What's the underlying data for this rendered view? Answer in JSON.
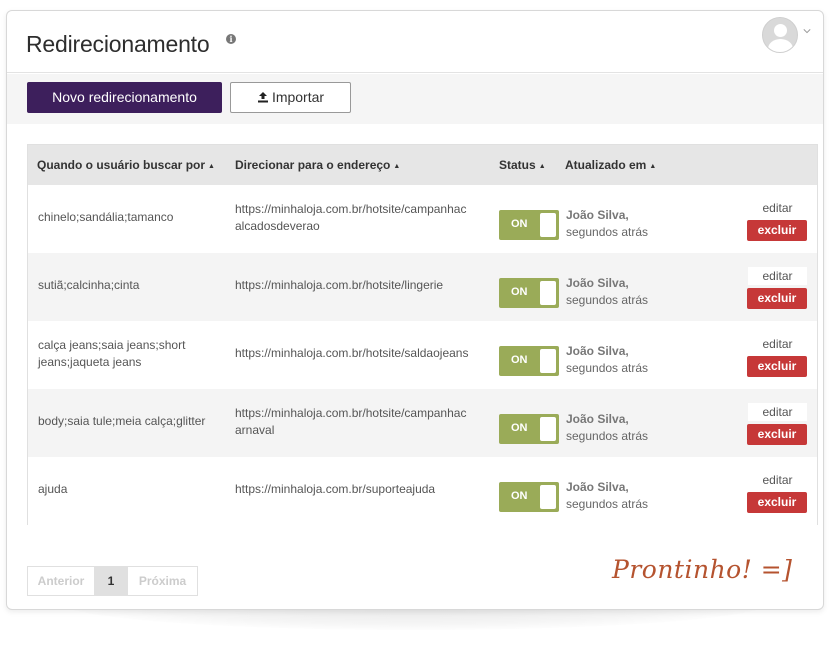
{
  "header": {
    "title": "Redirecionamento",
    "info_icon": "info-icon",
    "avatar_icon": "user-avatar-icon",
    "menu_icon": "chevron-down-icon"
  },
  "toolbar": {
    "new_label": "Novo redirecionamento",
    "import_label": "Importar",
    "import_icon": "upload-icon",
    "primary_color": "#3d1f5c"
  },
  "table": {
    "columns": [
      {
        "label": "Quando o usuário buscar por",
        "sort_icon": "sort-up-icon"
      },
      {
        "label": "Direcionar para o endereço",
        "sort_icon": "sort-up-icon"
      },
      {
        "label": "Status",
        "sort_icon": "sort-up-icon"
      },
      {
        "label": "Atualizado em",
        "sort_icon": "sort-up-icon"
      }
    ],
    "rows": [
      {
        "query_lines": [
          "chinelo;sandália;tamanco"
        ],
        "url_lines": [
          "https://minhaloja.com.br/hotsite/campanhac",
          "alcadosdeverao"
        ],
        "status": "ON",
        "updated_by": "João Silva,",
        "updated_when": "segundos atrás",
        "edit_label": "editar",
        "delete_label": "excluir"
      },
      {
        "query_lines": [
          "sutiã;calcinha;cinta"
        ],
        "url_lines": [
          "https://minhaloja.com.br/hotsite/lingerie"
        ],
        "status": "ON",
        "updated_by": "João Silva,",
        "updated_when": "segundos atrás",
        "edit_label": "editar",
        "delete_label": "excluir"
      },
      {
        "query_lines": [
          "calça jeans;saia jeans;short",
          "jeans;jaqueta jeans"
        ],
        "url_lines": [
          "https://minhaloja.com.br/hotsite/saldaojeans"
        ],
        "status": "ON",
        "updated_by": "João Silva,",
        "updated_when": "segundos atrás",
        "edit_label": "editar",
        "delete_label": "excluir"
      },
      {
        "query_lines": [
          "body;saia tule;meia calça;glitter"
        ],
        "url_lines": [
          "https://minhaloja.com.br/hotsite/campanhac",
          "arnaval"
        ],
        "status": "ON",
        "updated_by": "João Silva,",
        "updated_when": "segundos atrás",
        "edit_label": "editar",
        "delete_label": "excluir"
      },
      {
        "query_lines": [
          "ajuda"
        ],
        "url_lines": [
          "https://minhaloja.com.br/suporteajuda"
        ],
        "status": "ON",
        "updated_by": "João Silva,",
        "updated_when": "segundos atrás",
        "edit_label": "editar",
        "delete_label": "excluir"
      }
    ],
    "toggle_color": "#9aab58",
    "delete_color": "#c63838"
  },
  "pagination": {
    "prev_label": "Anterior",
    "current_page": "1",
    "next_label": "Próxima"
  },
  "annotation": {
    "text": "Prontinho! =]",
    "color": "#b5532f"
  }
}
